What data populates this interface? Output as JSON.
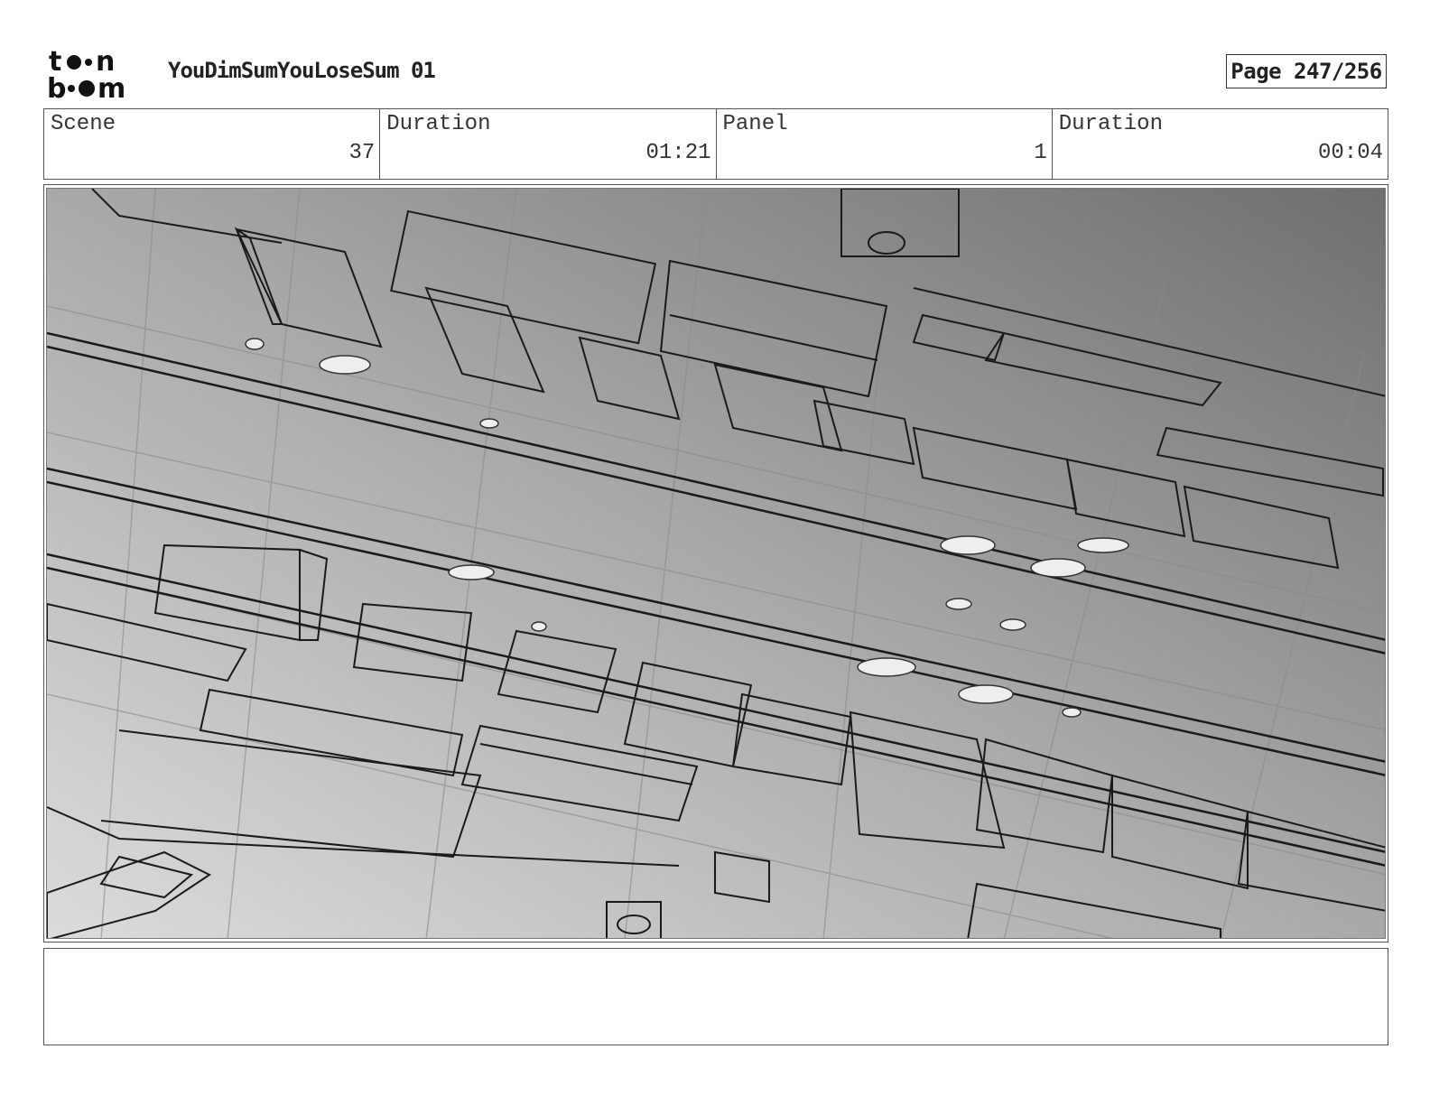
{
  "header": {
    "logo_text_top": "toon",
    "logo_text_bottom": "boom",
    "title": "YouDimSumYouLoseSum 01",
    "page_label": "Page 247/256"
  },
  "info": {
    "scene_label": "Scene",
    "scene_value": "37",
    "scene_duration_label": "Duration",
    "scene_duration_value": "01:21",
    "panel_label": "Panel",
    "panel_value": "1",
    "panel_duration_label": "Duration",
    "panel_duration_value": "00:04"
  },
  "panel": {
    "image_description_icon": "storyboard-sketch-street-aerial"
  },
  "notes": {
    "text": ""
  }
}
